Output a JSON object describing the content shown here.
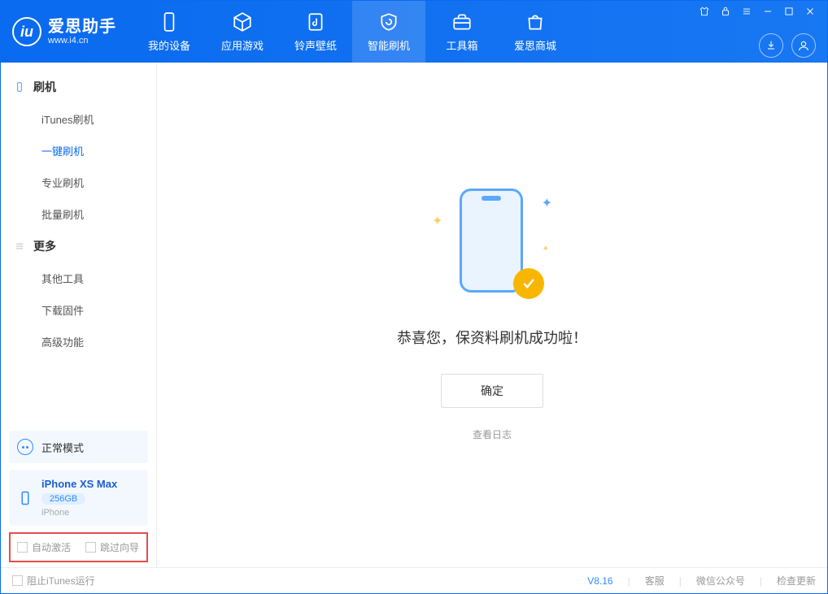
{
  "app": {
    "title": "爱思助手",
    "subtitle": "www.i4.cn"
  },
  "nav": [
    {
      "label": "我的设备"
    },
    {
      "label": "应用游戏"
    },
    {
      "label": "铃声壁纸"
    },
    {
      "label": "智能刷机"
    },
    {
      "label": "工具箱"
    },
    {
      "label": "爱思商城"
    }
  ],
  "sidebar": {
    "section1": {
      "title": "刷机",
      "items": [
        "iTunes刷机",
        "一键刷机",
        "专业刷机",
        "批量刷机"
      ],
      "activeIndex": 1
    },
    "section2": {
      "title": "更多",
      "items": [
        "其他工具",
        "下载固件",
        "高级功能"
      ]
    }
  },
  "devicePanel": {
    "mode": "正常模式",
    "deviceName": "iPhone XS Max",
    "storage": "256GB",
    "deviceType": "iPhone"
  },
  "checkboxes": {
    "autoActivate": "自动激活",
    "skipGuide": "跳过向导"
  },
  "main": {
    "successTitle": "恭喜您，保资料刷机成功啦！",
    "confirmBtn": "确定",
    "viewLog": "查看日志"
  },
  "statusbar": {
    "blockItunes": "阻止iTunes运行",
    "version": "V8.16",
    "customerService": "客服",
    "wechat": "微信公众号",
    "checkUpdate": "检查更新"
  }
}
